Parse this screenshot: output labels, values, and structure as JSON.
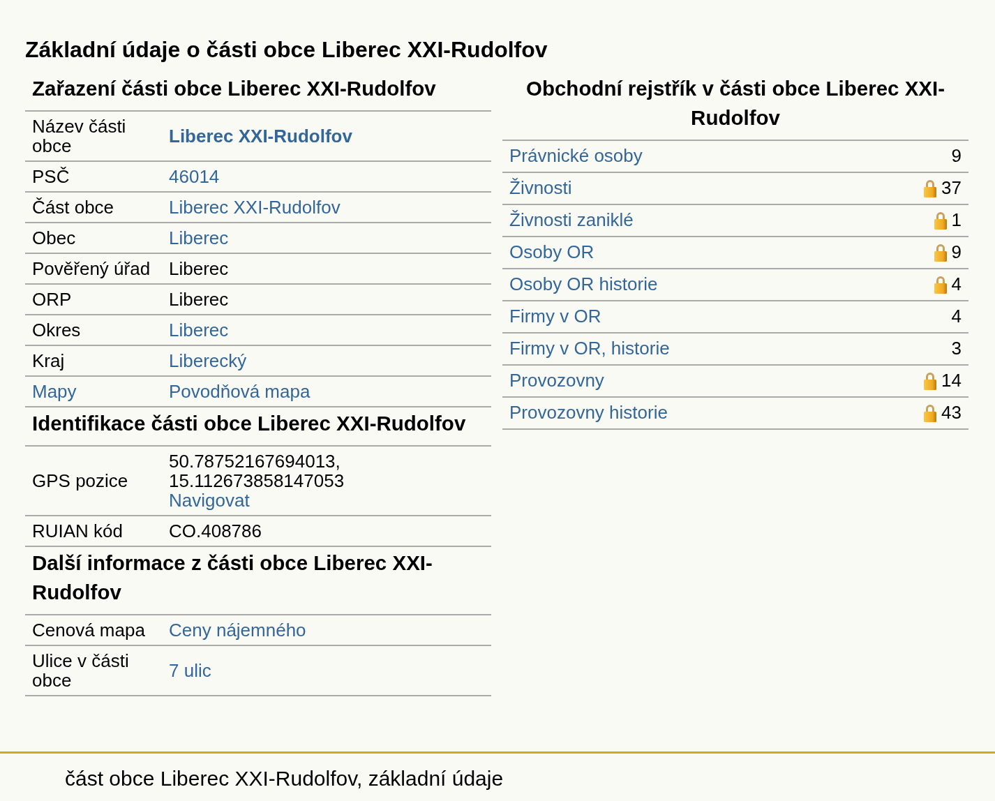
{
  "title": "Základní údaje o části obce Liberec XXI-Rudolfov",
  "left_sections": [
    {
      "heading": "Zařazení části obce Liberec XXI-Rudolfov",
      "rows": [
        {
          "label": "Název části obce",
          "label_link": false,
          "bold": true,
          "value": [
            {
              "text": "Liberec XXI-Rudolfov",
              "link": true
            }
          ]
        },
        {
          "label": "PSČ",
          "label_link": false,
          "value": [
            {
              "text": "46014",
              "link": true
            }
          ]
        },
        {
          "label": "Část obce",
          "label_link": false,
          "value": [
            {
              "text": "Liberec XXI-Rudolfov",
              "link": true
            }
          ]
        },
        {
          "label": "Obec",
          "label_link": false,
          "value": [
            {
              "text": "Liberec",
              "link": true
            }
          ]
        },
        {
          "label": "Pověřený úřad",
          "label_link": false,
          "value": [
            {
              "text": "Liberec",
              "link": false
            }
          ]
        },
        {
          "label": "ORP",
          "label_link": false,
          "value": [
            {
              "text": "Liberec",
              "link": false
            }
          ]
        },
        {
          "label": "Okres",
          "label_link": false,
          "value": [
            {
              "text": "Liberec",
              "link": true
            }
          ]
        },
        {
          "label": "Kraj",
          "label_link": false,
          "value": [
            {
              "text": "Liberecký",
              "link": true
            }
          ]
        },
        {
          "label": "Mapy",
          "label_link": true,
          "value": [
            {
              "text": "Povodňová mapa",
              "link": true
            }
          ]
        }
      ]
    },
    {
      "heading": "Identifikace části obce Liberec XXI-Rudolfov",
      "rows": [
        {
          "label": "GPS pozice",
          "label_link": false,
          "value": [
            {
              "text": "50.78752167694013,",
              "link": false
            },
            {
              "text": "15.112673858147053",
              "link": false
            },
            {
              "text": "Navigovat",
              "link": true
            }
          ]
        },
        {
          "label": "RUIAN kód",
          "label_link": false,
          "value": [
            {
              "text": "CO.408786",
              "link": false
            }
          ]
        }
      ]
    },
    {
      "heading": "Další informace z části obce Liberec XXI-Rudolfov",
      "rows": [
        {
          "label": "Cenová mapa",
          "label_link": false,
          "value": [
            {
              "text": "Ceny nájemného",
              "link": true
            }
          ]
        },
        {
          "label": "Ulice v části obce",
          "label_link": false,
          "value": [
            {
              "text": "7 ulic",
              "link": true
            }
          ]
        }
      ]
    }
  ],
  "register": {
    "heading": "Obchodní rejstřík v části obce Liberec XXI-Rudolfov",
    "rows": [
      {
        "label": "Právnické osoby",
        "count": "9",
        "locked": false
      },
      {
        "label": "Živnosti",
        "count": "37",
        "locked": true
      },
      {
        "label": "Živnosti zaniklé",
        "count": "1",
        "locked": true
      },
      {
        "label": "Osoby OR",
        "count": "9",
        "locked": true
      },
      {
        "label": "Osoby OR historie",
        "count": "4",
        "locked": true
      },
      {
        "label": "Firmy v OR",
        "count": "4",
        "locked": false
      },
      {
        "label": "Firmy v OR, historie",
        "count": "3",
        "locked": false
      },
      {
        "label": "Provozovny",
        "count": "14",
        "locked": true
      },
      {
        "label": "Provozovny historie",
        "count": "43",
        "locked": true
      }
    ]
  },
  "footer": "část obce Liberec XXI-Rudolfov, základní údaje"
}
